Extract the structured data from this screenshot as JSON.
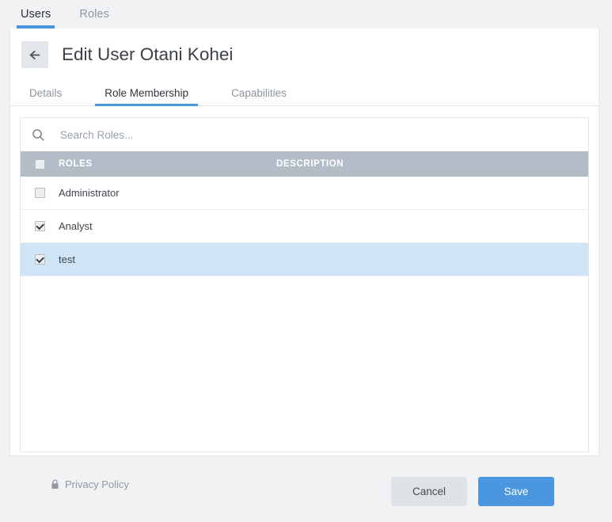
{
  "top_tabs": [
    {
      "label": "Users",
      "active": true
    },
    {
      "label": "Roles",
      "active": false
    }
  ],
  "header": {
    "back_icon": "arrow-left-icon",
    "title": "Edit User Otani Kohei"
  },
  "sub_tabs": [
    {
      "label": "Details",
      "active": false
    },
    {
      "label": "Role Membership",
      "active": true
    },
    {
      "label": "Capabilities",
      "active": false
    }
  ],
  "search": {
    "icon": "search-icon",
    "placeholder": "Search Roles...",
    "value": ""
  },
  "table": {
    "columns": {
      "roles": "ROLES",
      "description": "DESCRIPTION"
    },
    "select_all_checked": false,
    "rows": [
      {
        "name": "Administrator",
        "description": "",
        "checked": false,
        "selected": false
      },
      {
        "name": "Analyst",
        "description": "",
        "checked": true,
        "selected": false
      },
      {
        "name": "test",
        "description": "",
        "checked": true,
        "selected": true
      }
    ]
  },
  "footer": {
    "privacy_icon": "lock-icon",
    "privacy_label": "Privacy Policy",
    "cancel_label": "Cancel",
    "save_label": "Save"
  },
  "colors": {
    "accent": "#4a97e0",
    "table_header": "#b2bdc8",
    "row_selected": "#cfe5f6",
    "page_bg": "#f1f2f4"
  }
}
